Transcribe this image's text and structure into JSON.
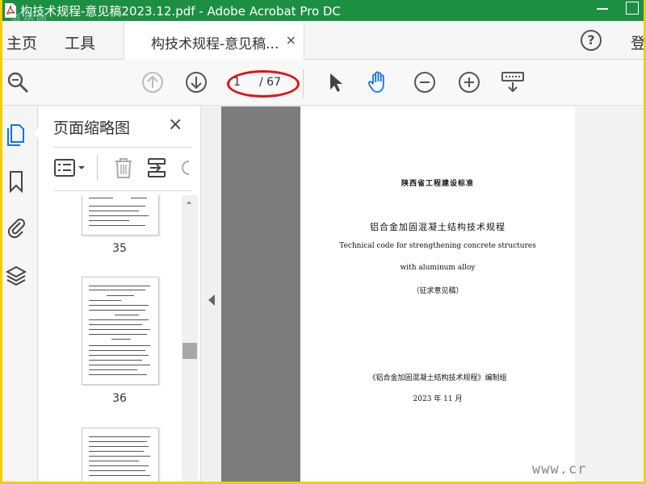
{
  "window": {
    "title": "构技术规程-意见稿2023.12.pdf - Adobe Acrobat Pro DC",
    "watermark_logo": "道格网"
  },
  "menubar": {
    "home": "主页",
    "tools": "工具",
    "doc_tab": "构技术规程-意见稿...",
    "tab_close": "×",
    "help": "?",
    "login": "登"
  },
  "toolbar": {
    "current_page": "1",
    "total_pages": "/ 67"
  },
  "sidebar": {
    "title": "页面缩略图",
    "close": "×",
    "thumbnails": [
      {
        "label": "35"
      },
      {
        "label": "36"
      }
    ]
  },
  "document": {
    "org": "陕西省工程建设标准",
    "title_cn": "铝合金加固混凝土结构技术规程",
    "title_en_1": "Technical code for strengthening concrete structures",
    "title_en_2": "with aluminum alloy",
    "draft": "（征求意见稿）",
    "compiler": "《铝合金加固混凝土结构技术规程》编制组",
    "date": "2023 年 11 月"
  },
  "site_watermark": "www.cr",
  "colors": {
    "titlebar": "#1d8f43",
    "accent": "#1473e6",
    "annotation": "#e01414",
    "frame": "#f0d000"
  }
}
